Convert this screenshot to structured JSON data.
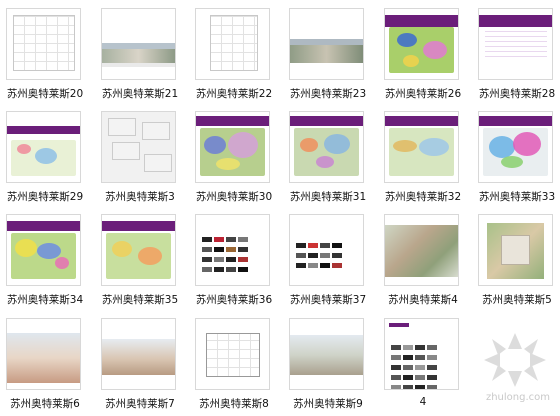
{
  "thumbnails": [
    {
      "label": "苏州奥特莱斯20"
    },
    {
      "label": "苏州奥特莱斯21"
    },
    {
      "label": "苏州奥特莱斯22"
    },
    {
      "label": "苏州奥特莱斯23"
    },
    {
      "label": "苏州奥特莱斯26"
    },
    {
      "label": "苏州奥特莱斯28"
    },
    {
      "label": "苏州奥特莱斯29"
    },
    {
      "label": "苏州奥特莱斯3"
    },
    {
      "label": "苏州奥特莱斯30"
    },
    {
      "label": "苏州奥特莱斯31"
    },
    {
      "label": "苏州奥特莱斯32"
    },
    {
      "label": "苏州奥特莱斯33"
    },
    {
      "label": "苏州奥特莱斯34"
    },
    {
      "label": "苏州奥特莱斯35"
    },
    {
      "label": "苏州奥特莱斯36"
    },
    {
      "label": "苏州奥特莱斯37"
    },
    {
      "label": "苏州奥特莱斯4"
    },
    {
      "label": "苏州奥特莱斯5"
    },
    {
      "label": "苏州奥特莱斯6"
    },
    {
      "label": "苏州奥特莱斯7"
    },
    {
      "label": "苏州奥特莱斯8"
    },
    {
      "label": "苏州奥特莱斯9"
    },
    {
      "label": "4"
    }
  ],
  "watermark": {
    "text": "zhulong.com"
  },
  "colors": {
    "accent_purple": "#6b1e7a",
    "label_text": "#111111",
    "thumb_border": "#d8d8d8"
  }
}
